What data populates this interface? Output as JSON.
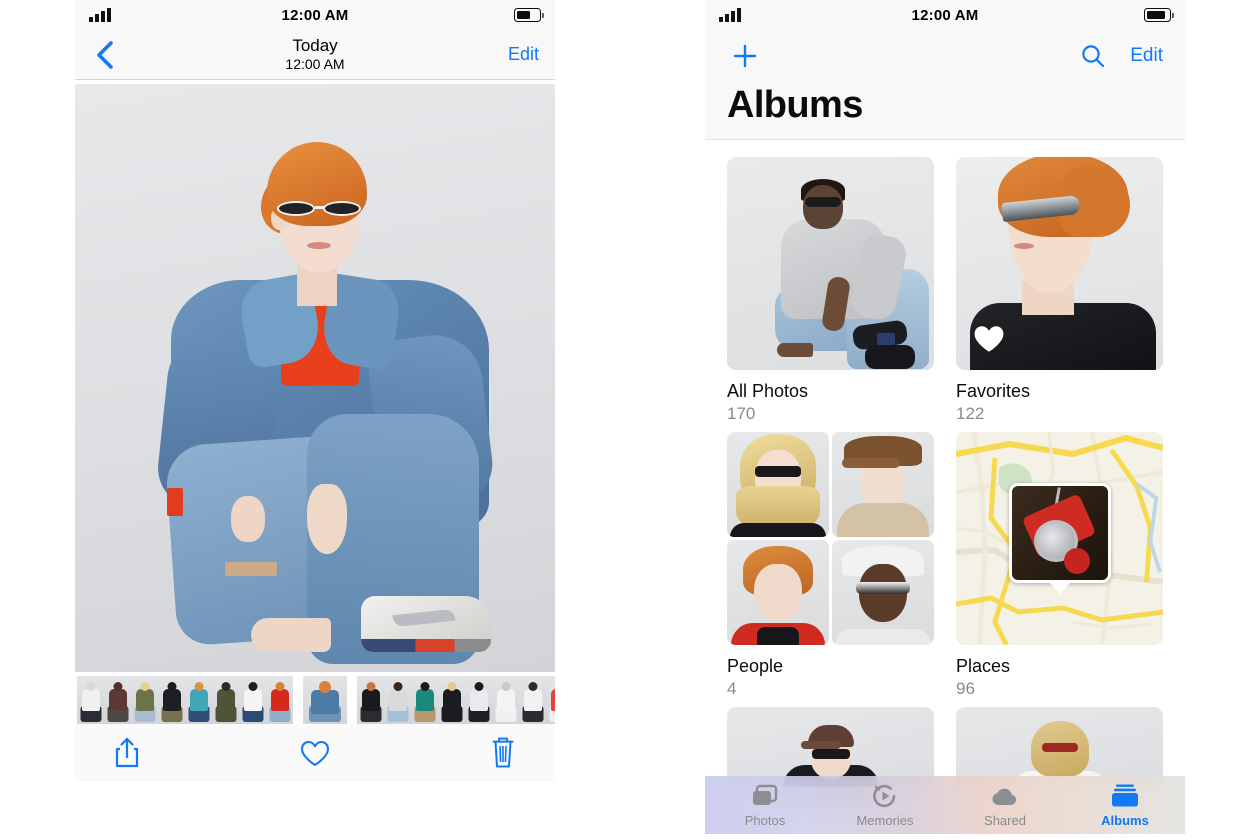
{
  "left_panel": {
    "status_bar": {
      "time": "12:00 AM",
      "signal_icon": "cellular-bars-icon",
      "battery_icon": "battery-icon",
      "battery_level": 60
    },
    "nav": {
      "back_icon": "chevron-left-icon",
      "title": "Today",
      "subtitle": "12:00 AM",
      "edit_label": "Edit"
    },
    "photo": {
      "name": "denim-jacket-model-photo",
      "alt": "Model kneeling in oversized denim jacket, red tee and sunglasses"
    },
    "filmstrip": {
      "name": "photo-filmstrip",
      "selected_index": 8,
      "thumbs": [
        {
          "hair": "#d9d9dc",
          "top": "#f0f0f0",
          "bottom": "#2a2c33"
        },
        {
          "hair": "#57302a",
          "top": "#5c3a33",
          "bottom": "#4a4a46"
        },
        {
          "hair": "#e3cf8f",
          "top": "#6d7348",
          "bottom": "#a9bdd2"
        },
        {
          "hair": "#1d1d20",
          "top": "#1e1f23",
          "bottom": "#7b6f4f"
        },
        {
          "hair": "#dd9545",
          "top": "#3fa7b5",
          "bottom": "#2f4e78"
        },
        {
          "hair": "#2b2b2e",
          "top": "#4d5536",
          "bottom": "#4d5536"
        },
        {
          "hair": "#2a1c14",
          "top": "#f5f5f5",
          "bottom": "#2c4a78"
        },
        {
          "hair": "#d9833a",
          "top": "#d6291d",
          "bottom": "#8fafcb"
        },
        {
          "hair": "#d9833a",
          "top": "#4d7ba8",
          "bottom": "#6d93b6"
        },
        {
          "hair": "#c9763a",
          "top": "#1a1a1e",
          "bottom": "#2b2b30"
        },
        {
          "hair": "#3a2519",
          "top": "#d8d9db",
          "bottom": "#a7c0d8"
        },
        {
          "hair": "#241710",
          "top": "#17897f",
          "bottom": "#b79a6c"
        },
        {
          "hair": "#e0cc91",
          "top": "#1b1b20",
          "bottom": "#1b1b20"
        },
        {
          "hair": "#1c1c20",
          "top": "#e9eaec",
          "bottom": "#1f1f24"
        },
        {
          "hair": "#c8c9cb",
          "top": "#f4f4f4",
          "bottom": "#f0f0f0"
        },
        {
          "hair": "#2b2b2f",
          "top": "#f2f2f2",
          "bottom": "#2a2a30"
        },
        {
          "hair": "#d9a24e",
          "top": "#e8413a",
          "bottom": "#f0f0f0"
        }
      ]
    },
    "toolbar": {
      "share_icon": "share-icon",
      "favorite_icon": "heart-icon",
      "delete_icon": "trash-icon"
    }
  },
  "right_panel": {
    "status_bar": {
      "time": "12:00 AM",
      "signal_icon": "cellular-bars-icon",
      "battery_icon": "battery-icon",
      "battery_level": 85
    },
    "header": {
      "add_icon": "plus-icon",
      "search_icon": "search-icon",
      "edit_label": "Edit",
      "title": "Albums"
    },
    "albums": [
      {
        "label": "All Photos",
        "count": "170",
        "tile": "all-photos"
      },
      {
        "label": "Favorites",
        "count": "122",
        "tile": "favorites",
        "badge_icon": "heart-filled-icon"
      },
      {
        "label": "People",
        "count": "4",
        "tile": "people"
      },
      {
        "label": "Places",
        "count": "96",
        "tile": "places"
      }
    ],
    "partial_row": [
      {
        "tile": "recents-cap-model"
      },
      {
        "tile": "recents-blonde-model"
      }
    ],
    "tabs": [
      {
        "label": "Photos",
        "icon": "photos-stack-icon",
        "active": false
      },
      {
        "label": "Memories",
        "icon": "memories-play-icon",
        "active": false
      },
      {
        "label": "Shared",
        "icon": "cloud-icon",
        "active": false
      },
      {
        "label": "Albums",
        "icon": "albums-folder-icon",
        "active": true
      }
    ]
  },
  "colors": {
    "accent": "#1279f2",
    "secondary_text": "#8a8a8e",
    "nav_bg": "#f8f8f8"
  }
}
